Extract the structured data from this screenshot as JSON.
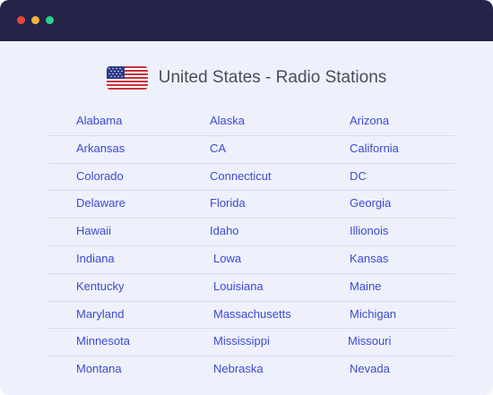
{
  "window": {
    "controls": [
      "close",
      "minimize",
      "maximize"
    ],
    "colors": {
      "titlebar": "#232448",
      "background": "#eef1fb",
      "link": "#3d49d6"
    }
  },
  "header": {
    "flag_icon": "us-flag-icon",
    "title": "United States - Radio Stations"
  },
  "states": [
    [
      "Alabama",
      "Alaska",
      "Arizona"
    ],
    [
      "Arkansas",
      "CA",
      "California"
    ],
    [
      "Colorado",
      "Connecticut",
      "DC"
    ],
    [
      "Delaware",
      "Florida",
      "Georgia"
    ],
    [
      "Hawaii",
      "Idaho",
      "Illionois"
    ],
    [
      "Indiana",
      "Lowa",
      "Kansas"
    ],
    [
      "Kentucky",
      "Louisiana",
      "Maine"
    ],
    [
      "Maryland",
      "Massachusetts",
      "Michigan"
    ],
    [
      "Minnesota",
      "Mississippi",
      "Missouri"
    ],
    [
      "Montana",
      "Nebraska",
      "Nevada"
    ]
  ]
}
